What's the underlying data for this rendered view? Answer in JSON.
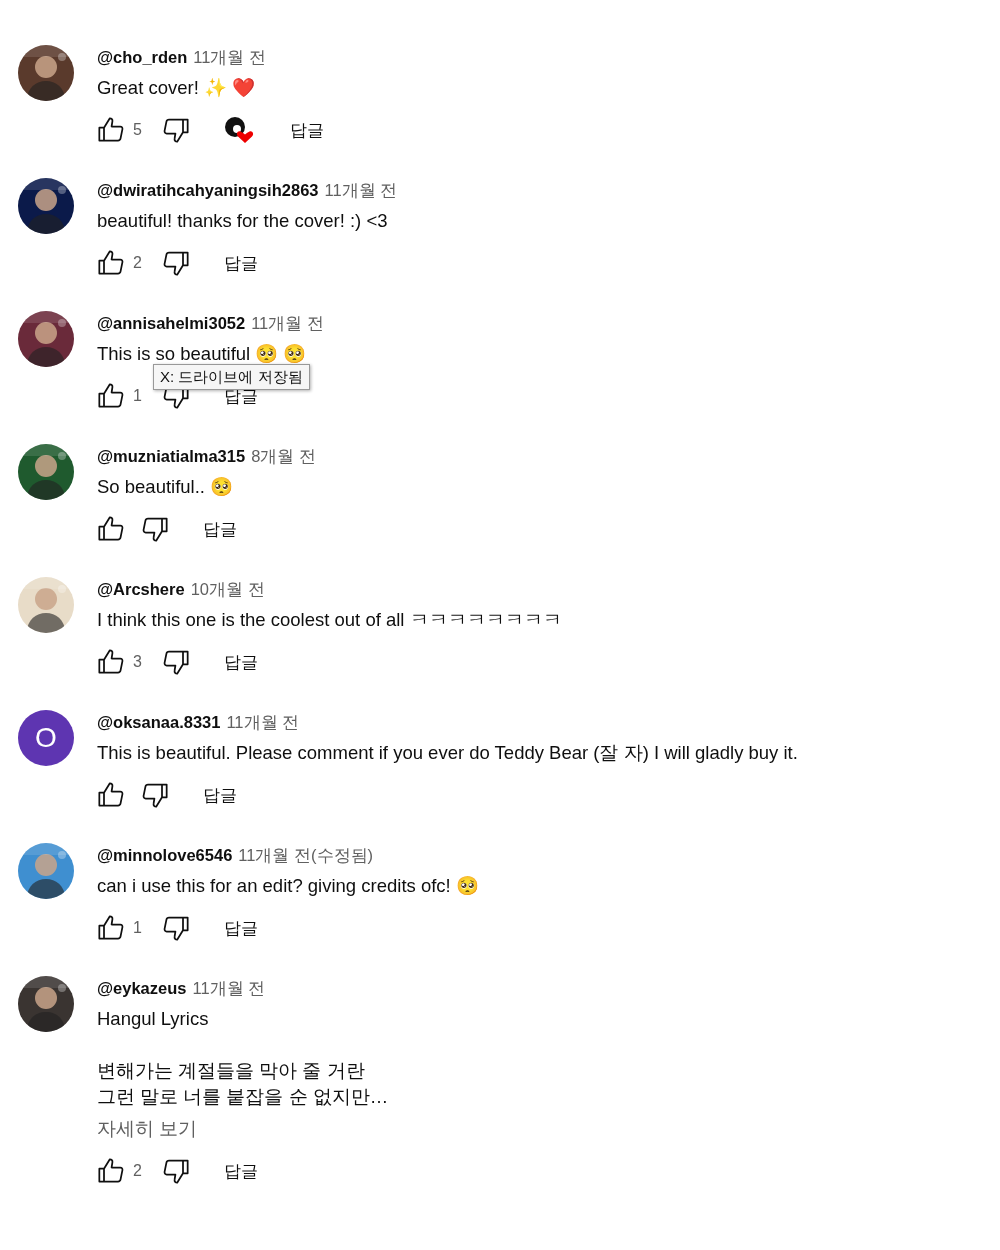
{
  "comments": [
    {
      "author": "@cho_rden",
      "time": "11개월 전",
      "avatar": {
        "kind": "picture"
      },
      "paragraphs": [
        [
          "Great cover! ✨ ❤️"
        ]
      ],
      "likes": "5",
      "creator_heart": true,
      "reply": "답글"
    },
    {
      "author": "@dwiratihcahyaningsih2863",
      "time": "11개월 전",
      "avatar": {
        "kind": "picture"
      },
      "paragraphs": [
        [
          "beautiful! thanks for the cover! :) <3"
        ]
      ],
      "likes": "2",
      "creator_heart": false,
      "reply": "답글"
    },
    {
      "author": "@annisahelmi3052",
      "time": "11개월 전",
      "avatar": {
        "kind": "picture"
      },
      "paragraphs": [
        [
          "This is so beautiful 🥺 🥺"
        ]
      ],
      "likes": "1",
      "creator_heart": false,
      "reply": "답글",
      "tooltip": "X: 드라이브에 저장됨"
    },
    {
      "author": "@muzniatialma315",
      "time": "8개월 전",
      "avatar": {
        "kind": "picture"
      },
      "paragraphs": [
        [
          "So beautiful.. 🥺"
        ]
      ],
      "creator_heart": false,
      "reply": "답글"
    },
    {
      "author": "@Arcshere",
      "time": "10개월 전",
      "avatar": {
        "kind": "picture"
      },
      "paragraphs": [
        [
          "I think this one is the coolest out of all ㅋㅋㅋㅋㅋㅋㅋㅋ"
        ]
      ],
      "likes": "3",
      "creator_heart": false,
      "reply": "답글"
    },
    {
      "author": "@oksanaa.8331",
      "time": "11개월 전",
      "avatar": {
        "kind": "letter",
        "letter": "O",
        "color": "#5e35b1"
      },
      "paragraphs": [
        [
          "This is beautiful. Please comment if you ever do Teddy Bear (잘 자) I will gladly buy it."
        ]
      ],
      "creator_heart": false,
      "reply": "답글"
    },
    {
      "author": "@minnolove6546",
      "time": "11개월 전",
      "edited": "(수정됨)",
      "avatar": {
        "kind": "picture"
      },
      "paragraphs": [
        [
          "can i use this for an edit? giving credits ofc! 🥺"
        ]
      ],
      "likes": "1",
      "creator_heart": false,
      "reply": "답글"
    },
    {
      "author": "@eykazeus",
      "time": "11개월 전",
      "avatar": {
        "kind": "picture"
      },
      "paragraphs": [
        [
          "Hangul Lyrics"
        ],
        [
          "변해가는 계절들을 막아 줄 거란",
          "그런 말로 너를 붙잡을 순 없지만…"
        ]
      ],
      "read_more": "자세히 보기",
      "likes": "2",
      "creator_heart": false,
      "reply": "답글"
    }
  ]
}
